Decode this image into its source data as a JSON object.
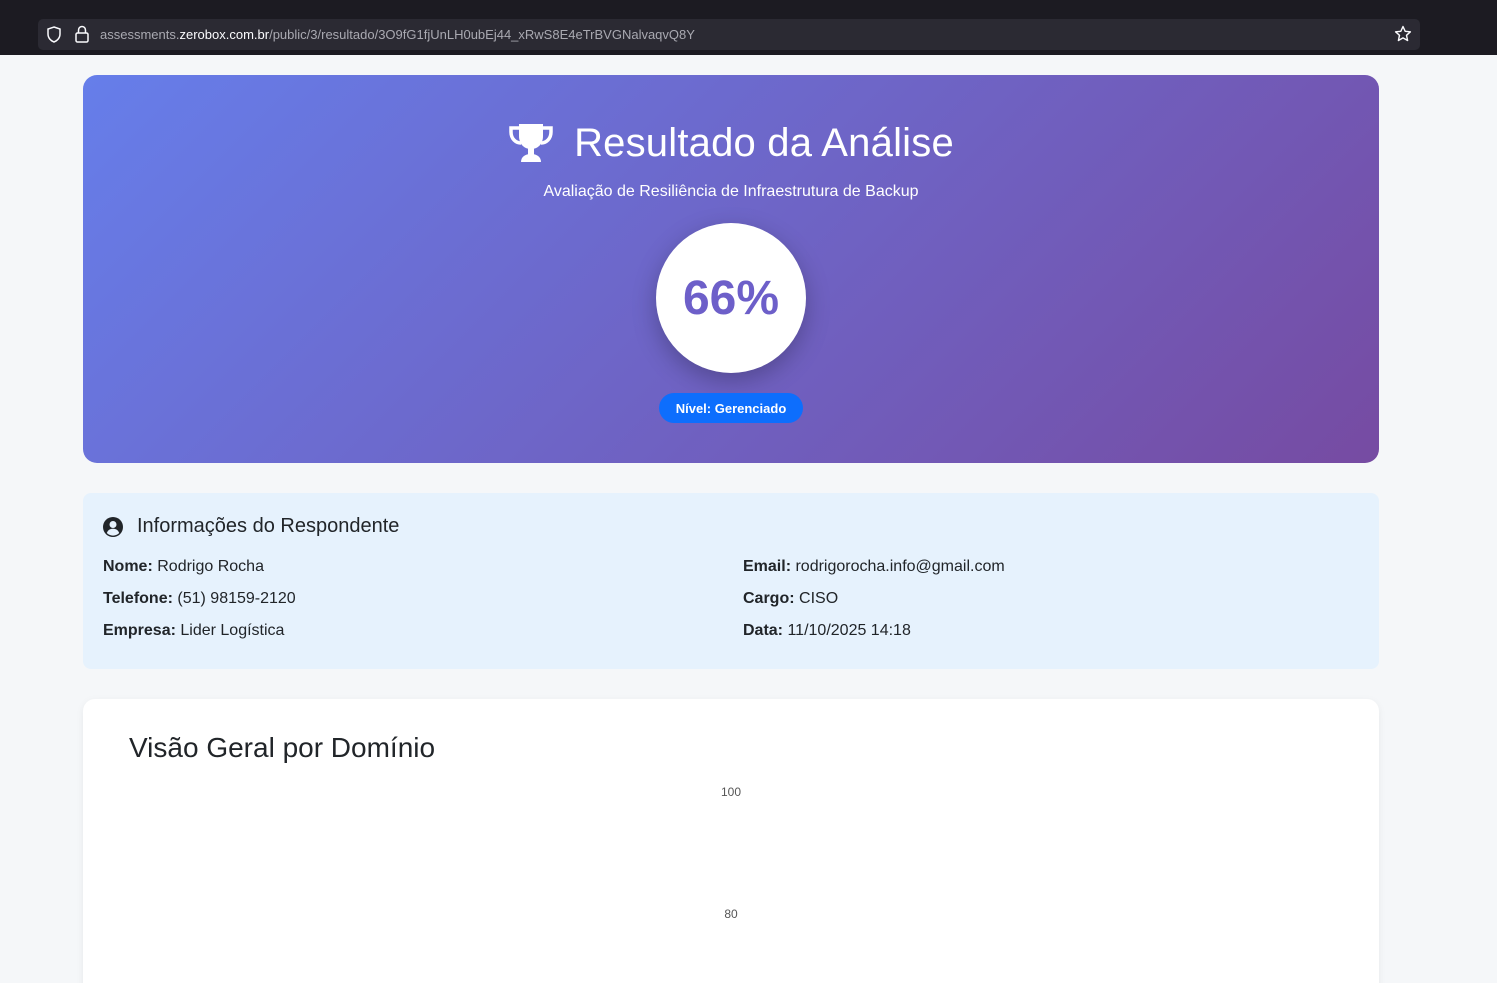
{
  "browser": {
    "url_prefix": "assessments.",
    "url_host": "zerobox.com.br",
    "url_path": "/public/3/resultado/3O9fG1fjUnLH0ubEj44_xRwS8E4eTrBVGNalvaqvQ8Y"
  },
  "hero": {
    "title": "Resultado da Análise",
    "subtitle": "Avaliação de Resiliência de Infraestrutura de Backup",
    "score": "66%",
    "level": "Nível: Gerenciado",
    "icon": "trophy-icon",
    "gradient_start": "#667eea",
    "gradient_end": "#764ba2",
    "badge_color": "#0d6efd"
  },
  "respondent": {
    "title": "Informações do Respondente",
    "icon": "user-circle-icon",
    "fields": [
      {
        "label": "Nome:",
        "value": "Rodrigo Rocha"
      },
      {
        "label": "Telefone:",
        "value": "(51) 98159-2120"
      },
      {
        "label": "Empresa:",
        "value": "Lider Logística"
      },
      {
        "label": "Email:",
        "value": "rodrigorocha.info@gmail.com"
      },
      {
        "label": "Cargo:",
        "value": "CISO"
      },
      {
        "label": "Data:",
        "value": "11/10/2025 14:18"
      }
    ]
  },
  "overview": {
    "title": "Visão Geral por Domínio"
  },
  "chart_data": {
    "type": "radar",
    "title": "Visão Geral por Domínio",
    "scale_ticks": [
      "100",
      "80"
    ],
    "ylim": [
      0,
      100
    ]
  }
}
